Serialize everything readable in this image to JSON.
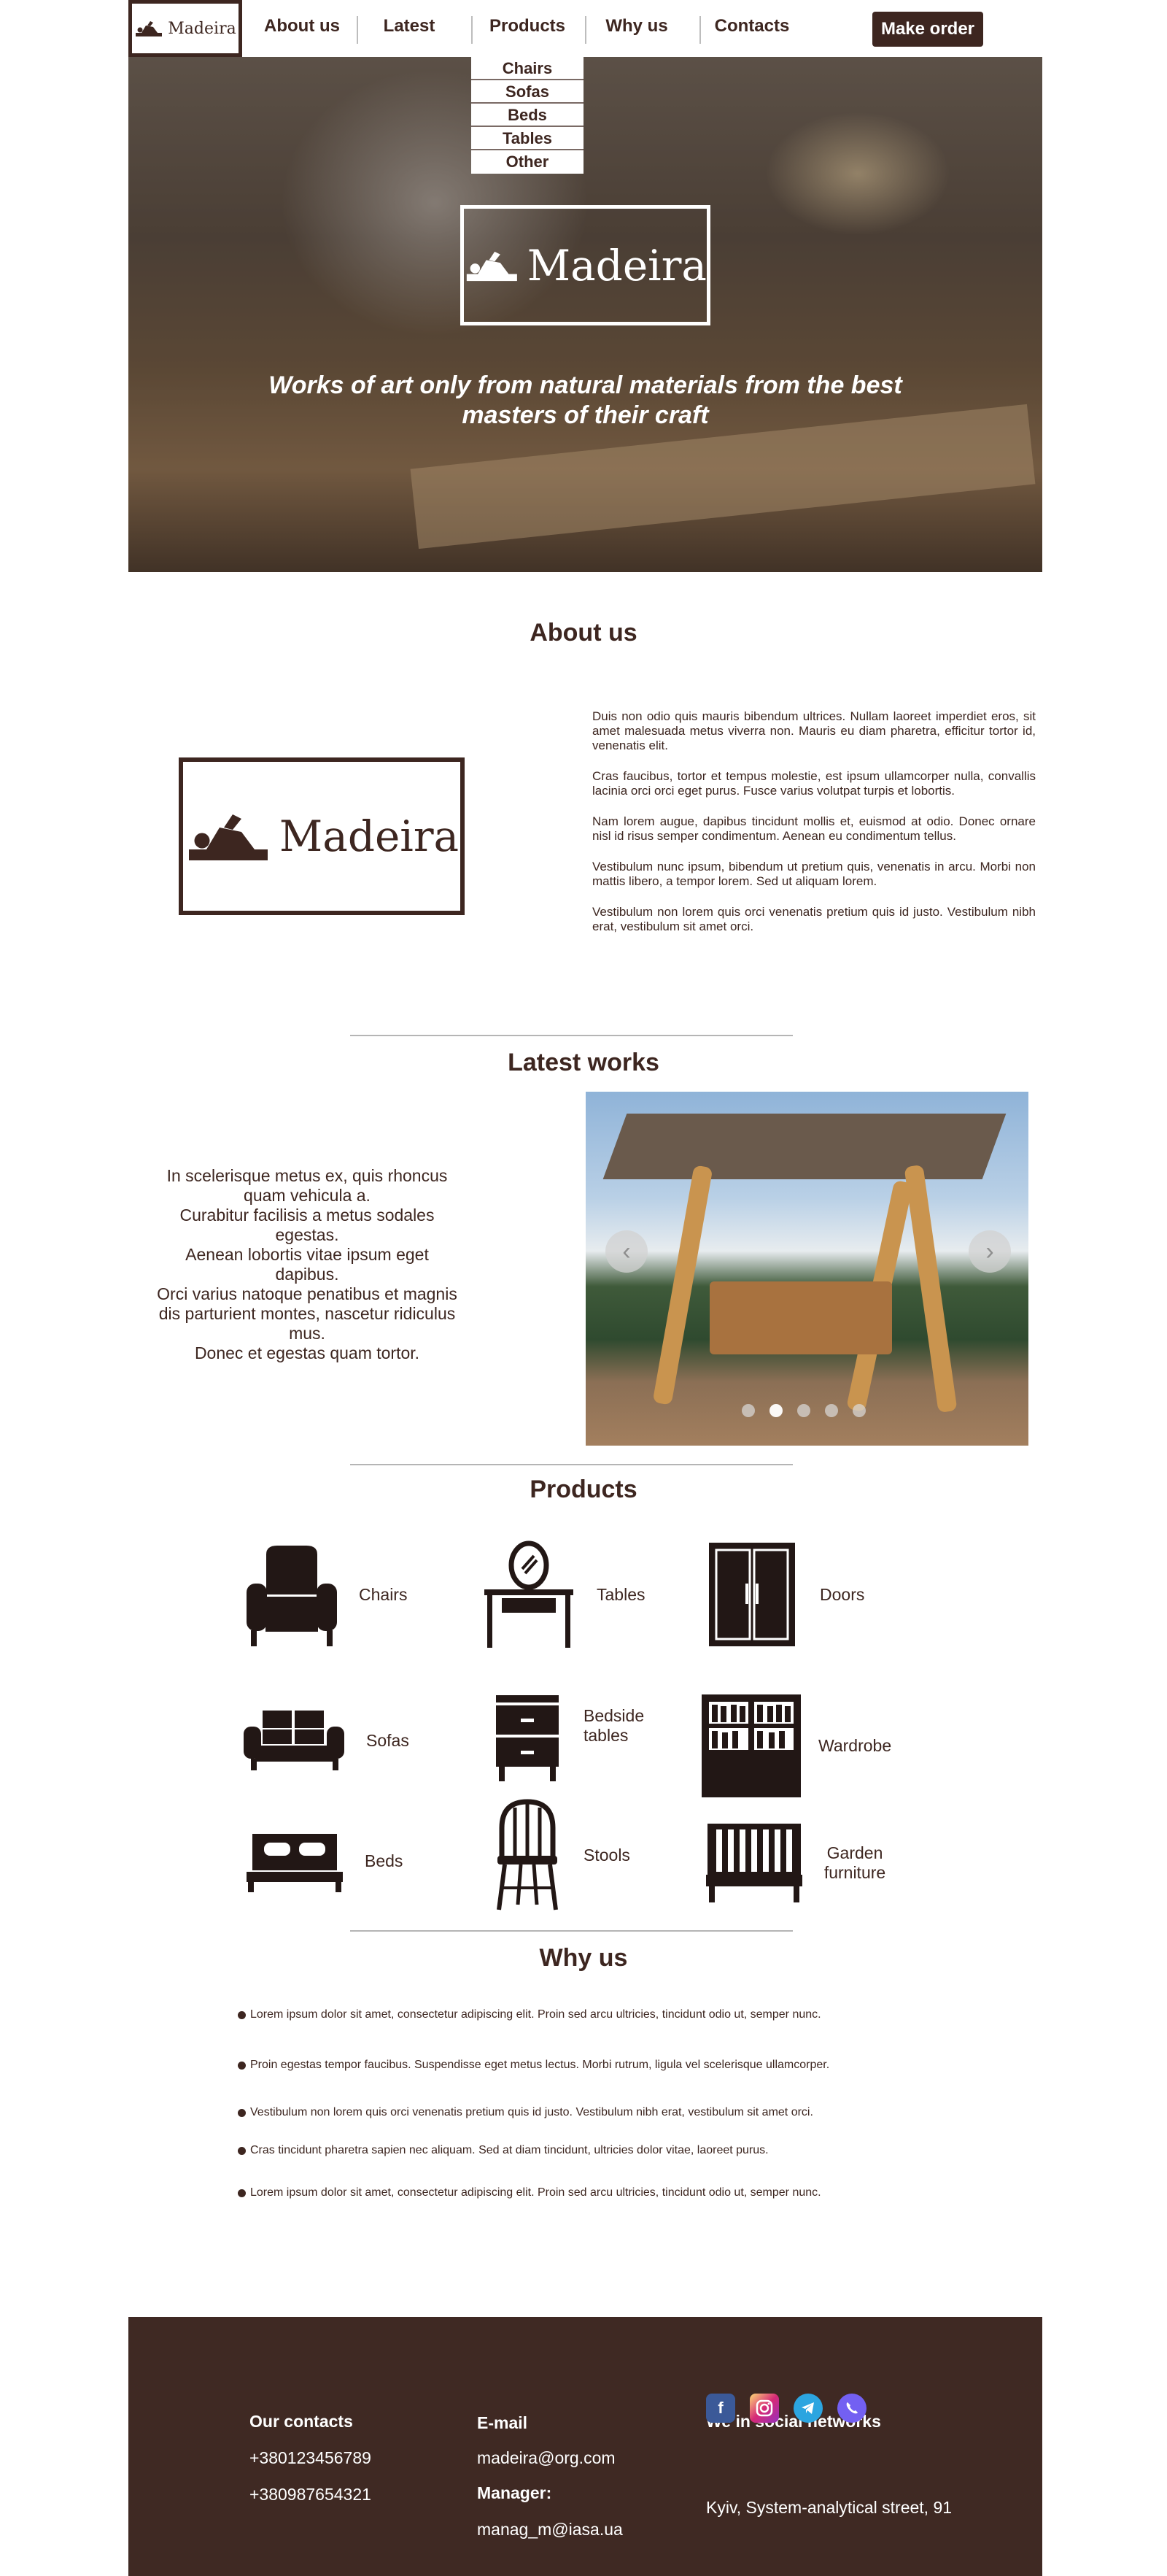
{
  "nav": {
    "logo_text": "Madeira",
    "items": [
      "About us",
      "Latest",
      "Products",
      "Why us",
      "Contacts"
    ],
    "order_button": "Make order",
    "dropdown": [
      "Chairs",
      "Sofas",
      "Beds",
      "Tables",
      "Other"
    ]
  },
  "hero": {
    "logo_text": "Madeira",
    "tagline": "Works of art only from natural materials from the best masters of their craft"
  },
  "about": {
    "title": "About us",
    "logo_text": "Madeira",
    "paragraphs": [
      "Duis non odio quis mauris bibendum ultrices. Nullam laoreet imperdiet eros, sit amet malesuada metus viverra non. Mauris eu diam pharetra, efficitur tortor id, venenatis elit.",
      "Cras faucibus, tortor et tempus molestie, est ipsum ullamcorper nulla, convallis lacinia orci orci eget purus. Fusce varius volutpat turpis et lobortis.",
      "Nam lorem augue, dapibus tincidunt mollis et, euismod at odio. Donec ornare nisl id risus semper condimentum. Aenean eu condimentum tellus.",
      "Vestibulum nunc ipsum, bibendum ut pretium quis, venenatis in arcu. Morbi non mattis libero, a tempor lorem. Sed ut aliquam lorem.",
      "Vestibulum non lorem quis orci venenatis pretium quis id justo. Vestibulum nibh erat, vestibulum sit amet orci."
    ]
  },
  "latest": {
    "title": "Latest works",
    "lines": [
      "In scelerisque metus ex, quis rhoncus quam vehicula a.",
      "Curabitur facilisis a metus sodales egestas.",
      "Aenean lobortis vitae ipsum eget dapibus.",
      "Orci varius natoque penatibus et magnis dis parturient montes, nascetur ridiculus mus.",
      "Donec et egestas quam tortor."
    ],
    "slide_count": 5,
    "active_slide": 2
  },
  "products": {
    "title": "Products",
    "items": [
      {
        "label": "Chairs",
        "icon": "armchair-icon"
      },
      {
        "label": "Tables",
        "icon": "vanity-table-icon"
      },
      {
        "label": "Doors",
        "icon": "cabinet-door-icon"
      },
      {
        "label": "Sofas",
        "icon": "sofa-icon"
      },
      {
        "label": "Bedside tables",
        "icon": "bedside-table-icon"
      },
      {
        "label": "Wardrobe",
        "icon": "wardrobe-icon"
      },
      {
        "label": "Beds",
        "icon": "bed-icon"
      },
      {
        "label": "Stools",
        "icon": "windsor-chair-icon"
      },
      {
        "label": "Garden furniture",
        "icon": "garden-bench-icon"
      }
    ]
  },
  "why": {
    "title": "Why us",
    "items": [
      "Lorem ipsum dolor sit amet, consectetur adipiscing elit. Proin sed arcu ultricies, tincidunt odio ut, semper nunc.",
      "Proin egestas tempor faucibus. Suspendisse eget metus lectus. Morbi rutrum, ligula vel scelerisque ullamcorper.",
      "Vestibulum non lorem quis orci venenatis pretium quis id justo. Vestibulum nibh erat, vestibulum sit amet orci.",
      "Cras tincidunt pharetra sapien nec aliquam. Sed at diam tincidunt, ultricies dolor vitae, laoreet purus.",
      "Lorem ipsum dolor sit amet, consectetur adipiscing elit. Proin sed arcu ultricies, tincidunt odio ut, semper nunc."
    ]
  },
  "footer": {
    "contacts_title": "Our contacts",
    "phones": [
      "+380123456789",
      "+380987654321"
    ],
    "email_title": "E-mail",
    "email": "madeira@org.com",
    "manager_title": "Manager:",
    "manager_email": "manag_m@iasa.ua",
    "social_title": "We in social networks",
    "social": [
      {
        "name": "facebook-icon",
        "color": "#3b5998"
      },
      {
        "name": "instagram-icon",
        "color": "#d6249f"
      },
      {
        "name": "telegram-icon",
        "color": "#2ca5e0"
      },
      {
        "name": "viber-icon",
        "color": "#7360f2"
      }
    ],
    "address": "Kyiv, System-analytical  street, 91"
  },
  "colors": {
    "brand_brown": "#3d2620",
    "footer_bg": "#3f2923"
  }
}
